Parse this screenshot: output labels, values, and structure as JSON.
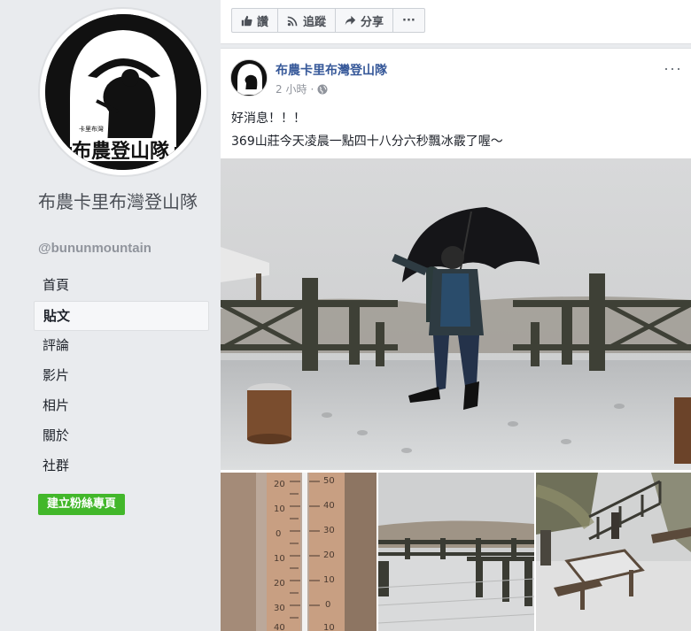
{
  "page": {
    "name": "布農卡里布灣登山隊",
    "handle": "@bununmountain",
    "logo_text": "布農登山隊",
    "logo_small_text": "卡里布灣"
  },
  "nav": [
    {
      "label": "首頁",
      "active": false
    },
    {
      "label": "貼文",
      "active": true
    },
    {
      "label": "評論",
      "active": false
    },
    {
      "label": "影片",
      "active": false
    },
    {
      "label": "相片",
      "active": false
    },
    {
      "label": "關於",
      "active": false
    },
    {
      "label": "社群",
      "active": false
    }
  ],
  "create_button": "建立粉絲專頁",
  "actions": {
    "like": "讚",
    "follow": "追蹤",
    "share": "分享",
    "more": "···"
  },
  "post": {
    "author": "布農卡里布灣登山隊",
    "time": "2 小時",
    "separator": "·",
    "more": "···",
    "line1": "好消息！！！",
    "line2": "369山莊今天凌晨一點四十八分六秒飄冰霰了喔～"
  },
  "colors": {
    "link": "#365899",
    "green": "#42b72a",
    "background": "#e9ebee"
  }
}
